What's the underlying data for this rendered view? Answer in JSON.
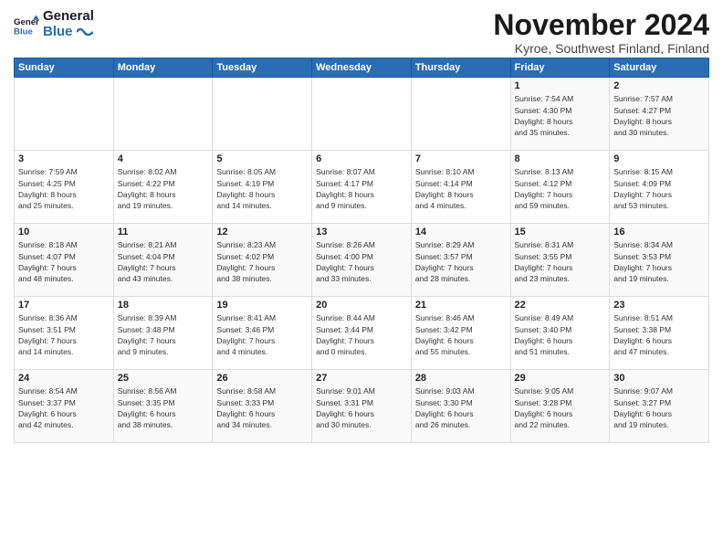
{
  "logo": {
    "line1": "General",
    "line2": "Blue"
  },
  "title": "November 2024",
  "subtitle": "Kyroe, Southwest Finland, Finland",
  "days_header": [
    "Sunday",
    "Monday",
    "Tuesday",
    "Wednesday",
    "Thursday",
    "Friday",
    "Saturday"
  ],
  "weeks": [
    [
      {
        "day": "",
        "info": ""
      },
      {
        "day": "",
        "info": ""
      },
      {
        "day": "",
        "info": ""
      },
      {
        "day": "",
        "info": ""
      },
      {
        "day": "",
        "info": ""
      },
      {
        "day": "1",
        "info": "Sunrise: 7:54 AM\nSunset: 4:30 PM\nDaylight: 8 hours\nand 35 minutes."
      },
      {
        "day": "2",
        "info": "Sunrise: 7:57 AM\nSunset: 4:27 PM\nDaylight: 8 hours\nand 30 minutes."
      }
    ],
    [
      {
        "day": "3",
        "info": "Sunrise: 7:59 AM\nSunset: 4:25 PM\nDaylight: 8 hours\nand 25 minutes."
      },
      {
        "day": "4",
        "info": "Sunrise: 8:02 AM\nSunset: 4:22 PM\nDaylight: 8 hours\nand 19 minutes."
      },
      {
        "day": "5",
        "info": "Sunrise: 8:05 AM\nSunset: 4:19 PM\nDaylight: 8 hours\nand 14 minutes."
      },
      {
        "day": "6",
        "info": "Sunrise: 8:07 AM\nSunset: 4:17 PM\nDaylight: 8 hours\nand 9 minutes."
      },
      {
        "day": "7",
        "info": "Sunrise: 8:10 AM\nSunset: 4:14 PM\nDaylight: 8 hours\nand 4 minutes."
      },
      {
        "day": "8",
        "info": "Sunrise: 8:13 AM\nSunset: 4:12 PM\nDaylight: 7 hours\nand 59 minutes."
      },
      {
        "day": "9",
        "info": "Sunrise: 8:15 AM\nSunset: 4:09 PM\nDaylight: 7 hours\nand 53 minutes."
      }
    ],
    [
      {
        "day": "10",
        "info": "Sunrise: 8:18 AM\nSunset: 4:07 PM\nDaylight: 7 hours\nand 48 minutes."
      },
      {
        "day": "11",
        "info": "Sunrise: 8:21 AM\nSunset: 4:04 PM\nDaylight: 7 hours\nand 43 minutes."
      },
      {
        "day": "12",
        "info": "Sunrise: 8:23 AM\nSunset: 4:02 PM\nDaylight: 7 hours\nand 38 minutes."
      },
      {
        "day": "13",
        "info": "Sunrise: 8:26 AM\nSunset: 4:00 PM\nDaylight: 7 hours\nand 33 minutes."
      },
      {
        "day": "14",
        "info": "Sunrise: 8:29 AM\nSunset: 3:57 PM\nDaylight: 7 hours\nand 28 minutes."
      },
      {
        "day": "15",
        "info": "Sunrise: 8:31 AM\nSunset: 3:55 PM\nDaylight: 7 hours\nand 23 minutes."
      },
      {
        "day": "16",
        "info": "Sunrise: 8:34 AM\nSunset: 3:53 PM\nDaylight: 7 hours\nand 19 minutes."
      }
    ],
    [
      {
        "day": "17",
        "info": "Sunrise: 8:36 AM\nSunset: 3:51 PM\nDaylight: 7 hours\nand 14 minutes."
      },
      {
        "day": "18",
        "info": "Sunrise: 8:39 AM\nSunset: 3:48 PM\nDaylight: 7 hours\nand 9 minutes."
      },
      {
        "day": "19",
        "info": "Sunrise: 8:41 AM\nSunset: 3:46 PM\nDaylight: 7 hours\nand 4 minutes."
      },
      {
        "day": "20",
        "info": "Sunrise: 8:44 AM\nSunset: 3:44 PM\nDaylight: 7 hours\nand 0 minutes."
      },
      {
        "day": "21",
        "info": "Sunrise: 8:46 AM\nSunset: 3:42 PM\nDaylight: 6 hours\nand 55 minutes."
      },
      {
        "day": "22",
        "info": "Sunrise: 8:49 AM\nSunset: 3:40 PM\nDaylight: 6 hours\nand 51 minutes."
      },
      {
        "day": "23",
        "info": "Sunrise: 8:51 AM\nSunset: 3:38 PM\nDaylight: 6 hours\nand 47 minutes."
      }
    ],
    [
      {
        "day": "24",
        "info": "Sunrise: 8:54 AM\nSunset: 3:37 PM\nDaylight: 6 hours\nand 42 minutes."
      },
      {
        "day": "25",
        "info": "Sunrise: 8:56 AM\nSunset: 3:35 PM\nDaylight: 6 hours\nand 38 minutes."
      },
      {
        "day": "26",
        "info": "Sunrise: 8:58 AM\nSunset: 3:33 PM\nDaylight: 6 hours\nand 34 minutes."
      },
      {
        "day": "27",
        "info": "Sunrise: 9:01 AM\nSunset: 3:31 PM\nDaylight: 6 hours\nand 30 minutes."
      },
      {
        "day": "28",
        "info": "Sunrise: 9:03 AM\nSunset: 3:30 PM\nDaylight: 6 hours\nand 26 minutes."
      },
      {
        "day": "29",
        "info": "Sunrise: 9:05 AM\nSunset: 3:28 PM\nDaylight: 6 hours\nand 22 minutes."
      },
      {
        "day": "30",
        "info": "Sunrise: 9:07 AM\nSunset: 3:27 PM\nDaylight: 6 hours\nand 19 minutes."
      }
    ]
  ]
}
